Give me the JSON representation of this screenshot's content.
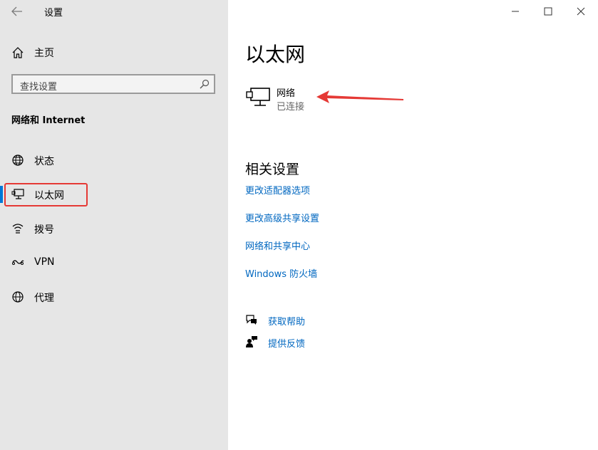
{
  "window": {
    "title": "设置",
    "controls": [
      "minimize",
      "maximize",
      "close"
    ]
  },
  "sidebar": {
    "home_label": "主页",
    "search": {
      "placeholder": "查找设置"
    },
    "section_title": "网络和 Internet",
    "items": [
      {
        "label": "状态",
        "icon": "status-globe-icon"
      },
      {
        "label": "以太网",
        "icon": "ethernet-icon",
        "active": true
      },
      {
        "label": "拨号",
        "icon": "dialup-icon"
      },
      {
        "label": "VPN",
        "icon": "vpn-icon"
      },
      {
        "label": "代理",
        "icon": "proxy-globe-icon"
      }
    ]
  },
  "main": {
    "title": "以太网",
    "network": {
      "name": "网络",
      "status": "已连接",
      "icon": "ethernet-monitor-icon"
    },
    "related_title": "相关设置",
    "links": [
      "更改适配器选项",
      "更改高级共享设置",
      "网络和共享中心",
      "Windows 防火墙"
    ],
    "help": [
      {
        "label": "获取帮助",
        "icon": "help-chat-icon"
      },
      {
        "label": "提供反馈",
        "icon": "feedback-icon"
      }
    ]
  },
  "colors": {
    "sidebar_bg": "#e6e6e6",
    "accent": "#0078d7",
    "link": "#0067c0",
    "annotation": "#e53935"
  }
}
